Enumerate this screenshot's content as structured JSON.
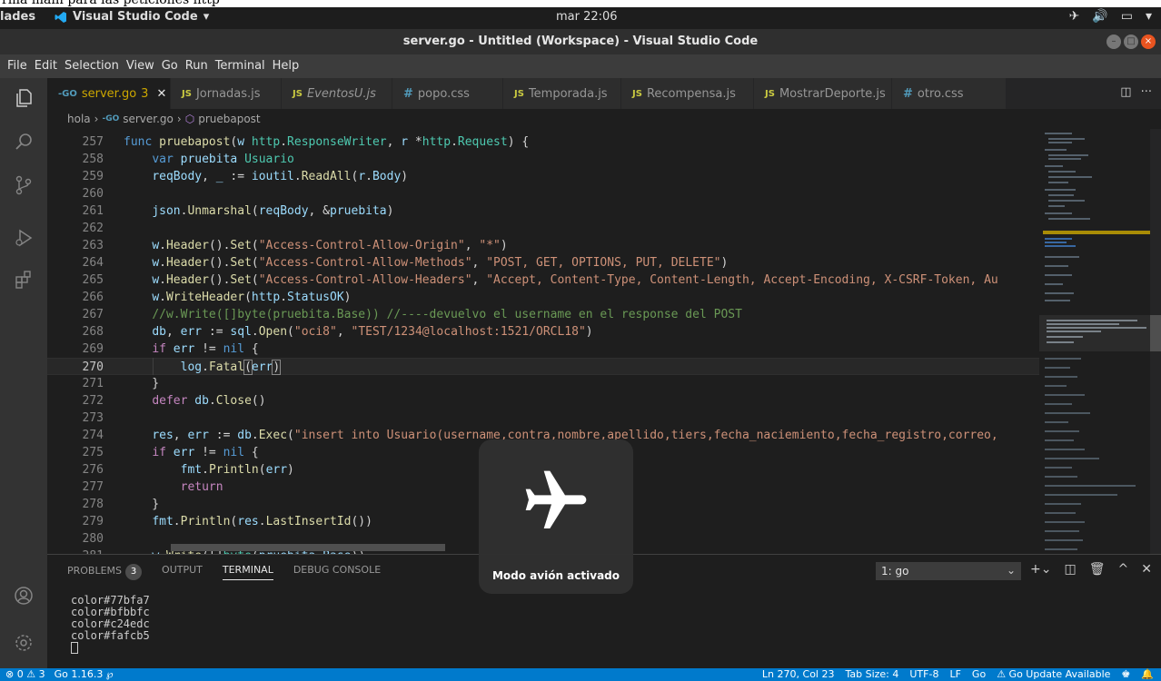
{
  "caption": "rma main para las peticiones http",
  "topbar": {
    "activities": "lades",
    "app_name": "Visual Studio Code",
    "clock": "mar 22:06"
  },
  "window": {
    "title": "server.go - Untitled (Workspace) - Visual Studio Code"
  },
  "menu": [
    "File",
    "Edit",
    "Selection",
    "View",
    "Go",
    "Run",
    "Terminal",
    "Help"
  ],
  "tabs": [
    {
      "lang": "go",
      "name": "server.go",
      "extra": "3"
    },
    {
      "lang": "JS",
      "name": "Jornadas.js"
    },
    {
      "lang": "JS",
      "name": "EventosU.js"
    },
    {
      "lang": "#",
      "name": "popo.css"
    },
    {
      "lang": "JS",
      "name": "Temporada.js"
    },
    {
      "lang": "JS",
      "name": "Recompensa.js"
    },
    {
      "lang": "JS",
      "name": "MostrarDeporte.js"
    },
    {
      "lang": "#",
      "name": "otro.css"
    }
  ],
  "breadcrumb": [
    "hola",
    "server.go",
    "pruebapost"
  ],
  "editor": {
    "line_numbers": [
      "257",
      "258",
      "259",
      "260",
      "261",
      "262",
      "263",
      "264",
      "265",
      "266",
      "267",
      "268",
      "269",
      "270",
      "271",
      "272",
      "273",
      "274",
      "275",
      "276",
      "277",
      "278",
      "279",
      "280",
      "281"
    ],
    "current_line": "270"
  },
  "panel": {
    "tabs": [
      "PROBLEMS",
      "OUTPUT",
      "TERMINAL",
      "DEBUG CONSOLE"
    ],
    "problems_count": "3",
    "terminal_select": "1: go",
    "terminal_lines": [
      "color#77bfa7",
      "color#bfbbfc",
      "color#c24edc",
      "color#fafcb5"
    ]
  },
  "status": {
    "left": [
      "⊗ 0 ⚠ 3",
      "Go 1.16.3 ℘"
    ],
    "right": [
      "Ln 270, Col 23",
      "Tab Size: 4",
      "UTF-8",
      "LF",
      "Go",
      "⚠ Go Update Available"
    ]
  },
  "osd": {
    "label": "Modo avión activado"
  }
}
